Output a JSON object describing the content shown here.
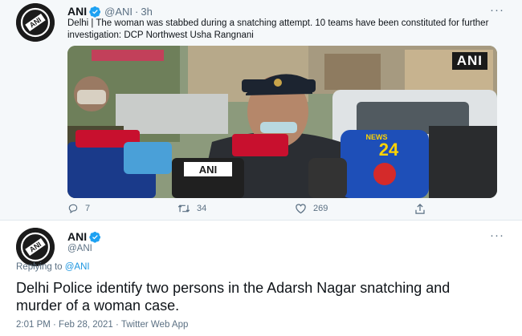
{
  "tweet1": {
    "author_name": "ANI",
    "handle": "@ANI",
    "separator": "·",
    "time": "3h",
    "more": "···",
    "text": "Delhi | The woman was stabbed during a snatching attempt. 10 teams have been constituted for further investigation: DCP Northwest Usha Rangnani",
    "media": {
      "badge": "ANI",
      "mic_labels": [
        "NEWS 24",
        "ANI",
        "NEWS"
      ]
    },
    "actions": {
      "reply_icon": "reply-icon",
      "reply_count": "7",
      "retweet_icon": "retweet-icon",
      "retweet_count": "34",
      "like_icon": "heart-icon",
      "like_count": "269",
      "share_icon": "share-icon"
    }
  },
  "tweet2": {
    "author_name": "ANI",
    "handle": "@ANI",
    "more": "···",
    "replying_prefix": "Replying to ",
    "replying_to": "@ANI",
    "text": "Delhi Police identify two persons in the Adarsh Nagar snatching and murder of a woman case.",
    "timestamp": "2:01 PM · Feb 28, 2021 · Twitter Web App"
  },
  "colors": {
    "verified": "#1da1f2",
    "link": "#1b95e0",
    "muted": "#5b7083",
    "text": "#0f1419"
  }
}
